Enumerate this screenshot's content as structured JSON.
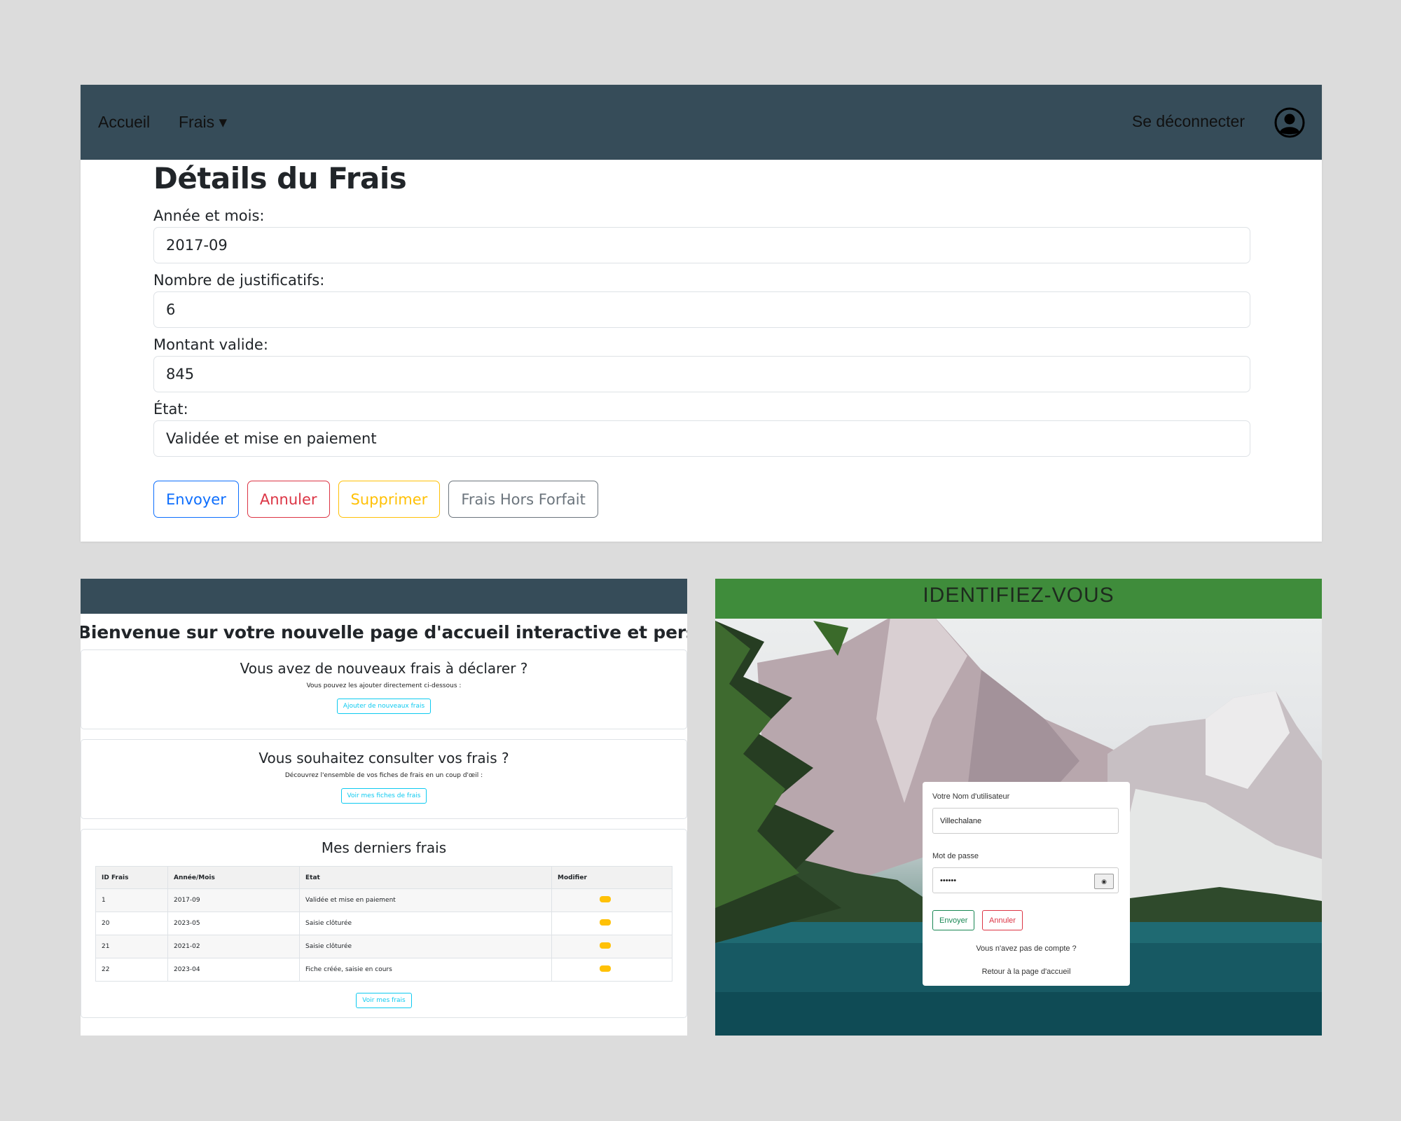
{
  "details": {
    "nav": {
      "home": "Accueil",
      "frais": "Frais ▾",
      "logout": "Se déconnecter"
    },
    "title": "Détails du Frais",
    "fields": [
      {
        "label": "Année et mois:",
        "value": "2017-09"
      },
      {
        "label": "Nombre de justificatifs:",
        "value": "6"
      },
      {
        "label": "Montant valide:",
        "value": "845"
      },
      {
        "label": "État:",
        "value": "Validée et mise en paiement"
      }
    ],
    "buttons": {
      "send": "Envoyer",
      "cancel": "Annuler",
      "delete": "Supprimer",
      "hors_forfait": "Frais Hors Forfait"
    }
  },
  "home": {
    "welcome": "Bienvenue sur votre nouvelle page d'accueil interactive et personnalisée",
    "card_new": {
      "title": "Vous avez de nouveaux frais à déclarer ?",
      "subtitle": "Vous pouvez les ajouter directement ci-dessous :",
      "button": "Ajouter de nouveaux frais"
    },
    "card_consult": {
      "title": "Vous souhaitez consulter vos frais ?",
      "subtitle": "Découvrez l'ensemble de vos fiches de frais en un coup d'œil :",
      "button": "Voir mes fiches de frais"
    },
    "card_last": {
      "title": "Mes derniers frais",
      "columns": [
        "ID Frais",
        "Année/Mois",
        "Etat",
        "Modifier"
      ],
      "rows": [
        {
          "id": "1",
          "month": "2017-09",
          "state": "Validée et mise en paiement"
        },
        {
          "id": "20",
          "month": "2023-05",
          "state": "Saisie clôturée"
        },
        {
          "id": "21",
          "month": "2021-02",
          "state": "Saisie clôturée"
        },
        {
          "id": "22",
          "month": "2023-04",
          "state": "Fiche créée, saisie en cours"
        }
      ],
      "button": "Voir mes frais"
    }
  },
  "login": {
    "title": "IDENTIFIEZ-VOUS",
    "username_label": "Votre Nom d'utilisateur",
    "username_value": "Villechalane",
    "password_label": "Mot de passe",
    "password_value": "••••••",
    "eye_icon": "◉",
    "send": "Envoyer",
    "cancel": "Annuler",
    "no_account": "Vous n'avez pas de compte ?",
    "back_home": "Retour à la page d'accueil"
  },
  "colors": {
    "navbar": "#364c59",
    "primary": "#0d6efd",
    "danger": "#dc3545",
    "warning": "#ffc107",
    "secondary": "#6c757d",
    "info": "#0dcaf0",
    "success": "#198754",
    "login_banner": "#3f8c3b"
  }
}
